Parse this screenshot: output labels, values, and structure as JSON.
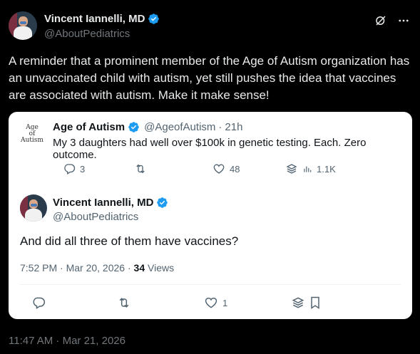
{
  "author": {
    "name": "Vincent Iannelli, MD",
    "handle": "@AboutPediatrics"
  },
  "post": {
    "text": "A reminder that a prominent member of the Age of Autism organization has an unvaccinated child with autism, yet still pushes the idea that vaccines are associated with autism. Make it make sense!",
    "timestamp": "11:47 AM · Mar 21, 2026"
  },
  "quoted": {
    "logo_lines": [
      "Age",
      "of",
      "Autism"
    ],
    "name": "Age of Autism",
    "handle": "@AgeofAutism",
    "time": "21h",
    "text": "My 3 daughters had well over $100k in genetic testing. Each. Zero outcome.",
    "replies": "3",
    "likes": "48",
    "views": "1.1K"
  },
  "reply": {
    "name": "Vincent Iannelli, MD",
    "handle": "@AboutPediatrics",
    "text": "And did all three of them have vaccines?",
    "meta": "7:52 PM · Mar 20, 2026 · ",
    "views_count": "34",
    "views_label": " Views",
    "likes": "1"
  },
  "colors": {
    "verified": "#1d9bf0",
    "background": "#000000",
    "card": "#ffffff"
  }
}
